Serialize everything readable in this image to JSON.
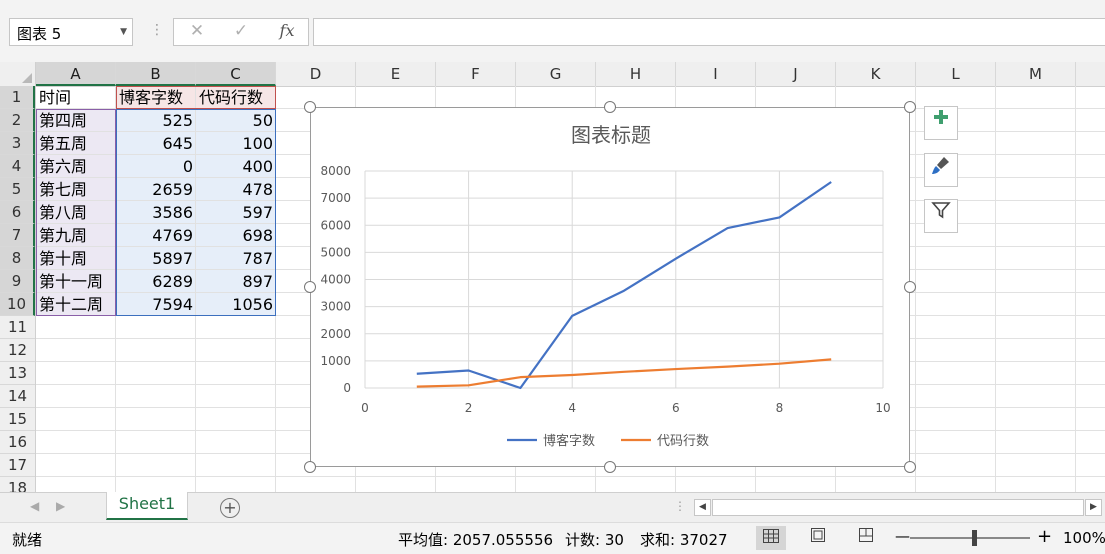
{
  "formula_bar": {
    "name_box": "图表 5",
    "cancel_icon": "✕",
    "enter_icon": "✓",
    "fx_label": "fx",
    "formula": ""
  },
  "columns": [
    "A",
    "B",
    "C",
    "D",
    "E",
    "F",
    "G",
    "H",
    "I",
    "J",
    "K",
    "L",
    "M"
  ],
  "rows": [
    "1",
    "2",
    "3",
    "4",
    "5",
    "6",
    "7",
    "8",
    "9",
    "10",
    "11",
    "12",
    "13",
    "14",
    "15",
    "16",
    "17",
    "18"
  ],
  "sheet": {
    "headers": [
      "时间",
      "博客字数",
      "代码行数"
    ],
    "data": [
      [
        "第四周",
        "525",
        "50"
      ],
      [
        "第五周",
        "645",
        "100"
      ],
      [
        "第六周",
        "0",
        "400"
      ],
      [
        "第七周",
        "2659",
        "478"
      ],
      [
        "第八周",
        "3586",
        "597"
      ],
      [
        "第九周",
        "4769",
        "698"
      ],
      [
        "第十周",
        "5897",
        "787"
      ],
      [
        "第十一周",
        "6289",
        "897"
      ],
      [
        "第十二周",
        "7594",
        "1056"
      ]
    ]
  },
  "chart_data": {
    "type": "line",
    "title": "图表标题",
    "x": [
      1,
      2,
      3,
      4,
      5,
      6,
      7,
      8,
      9
    ],
    "series": [
      {
        "name": "博客字数",
        "color": "#4472c4",
        "values": [
          525,
          645,
          0,
          2659,
          3586,
          4769,
          5897,
          6289,
          7594
        ]
      },
      {
        "name": "代码行数",
        "color": "#ed7d31",
        "values": [
          50,
          100,
          400,
          478,
          597,
          698,
          787,
          897,
          1056
        ]
      }
    ],
    "xlim": [
      0,
      10
    ],
    "ylim": [
      0,
      8000
    ],
    "xticks": [
      0,
      2,
      4,
      6,
      8,
      10
    ],
    "yticks": [
      0,
      1000,
      2000,
      3000,
      4000,
      5000,
      6000,
      7000,
      8000
    ],
    "grid": true,
    "legend": "bottom"
  },
  "chart_tools": {
    "elements_icon": "plus-icon",
    "styles_icon": "brush-icon",
    "filter_icon": "filter-icon"
  },
  "tabs": {
    "sheets": [
      "Sheet1"
    ],
    "add_label": "+"
  },
  "status": {
    "ready": "就绪",
    "average": "平均值: 2057.055556",
    "count": "计数: 30",
    "sum": "求和: 37027",
    "zoom": "100%",
    "zoom_minus": "—",
    "zoom_plus": "+"
  }
}
